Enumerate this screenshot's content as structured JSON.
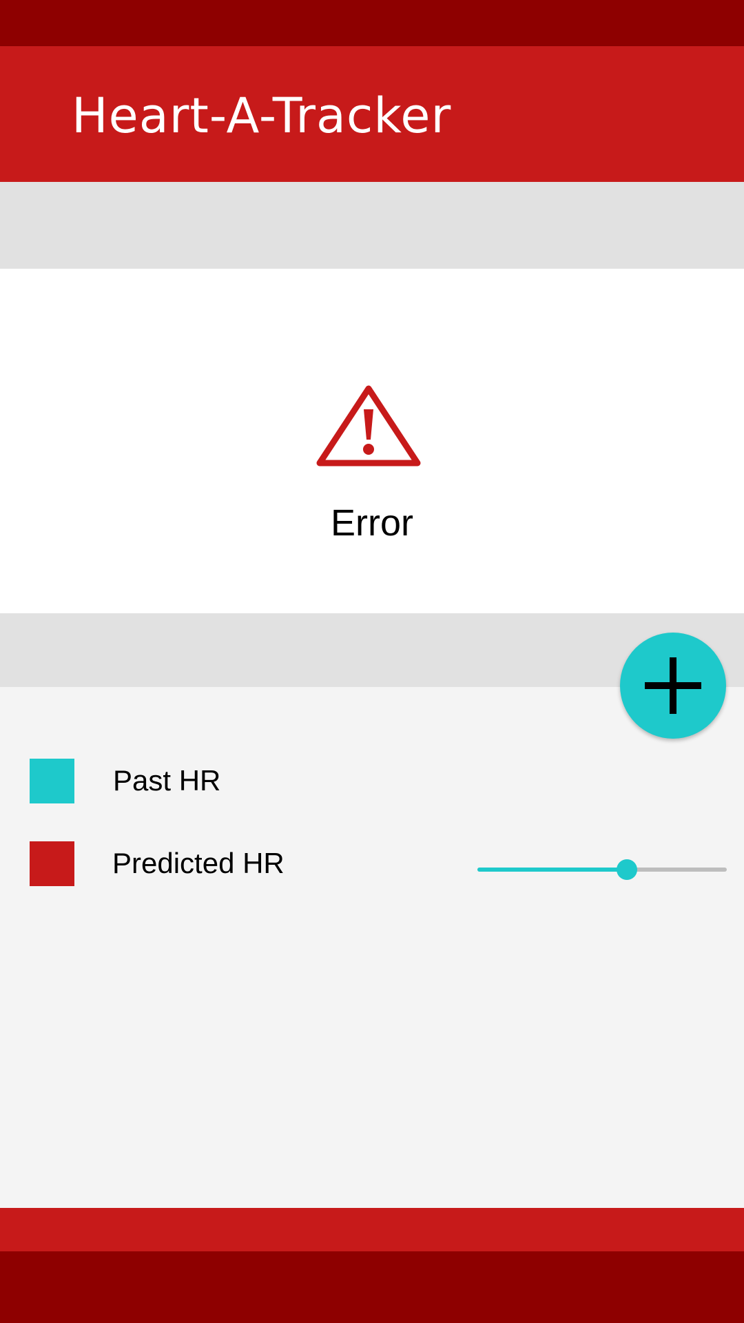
{
  "app": {
    "title": "Heart-A-Tracker"
  },
  "error": {
    "icon": "warning-icon",
    "message": "Error"
  },
  "fab": {
    "icon": "plus-icon"
  },
  "legend": {
    "items": [
      {
        "label": "Past HR",
        "color": "#1ec9cb"
      },
      {
        "label": "Predicted HR",
        "color": "#c71a1a"
      }
    ]
  },
  "slider": {
    "value_fraction": 0.6
  },
  "colors": {
    "primary": "#c71a1a",
    "primary_dark": "#8e0000",
    "accent": "#1ec9cb",
    "strip": "#e1e1e1",
    "surface": "#f4f4f4"
  }
}
